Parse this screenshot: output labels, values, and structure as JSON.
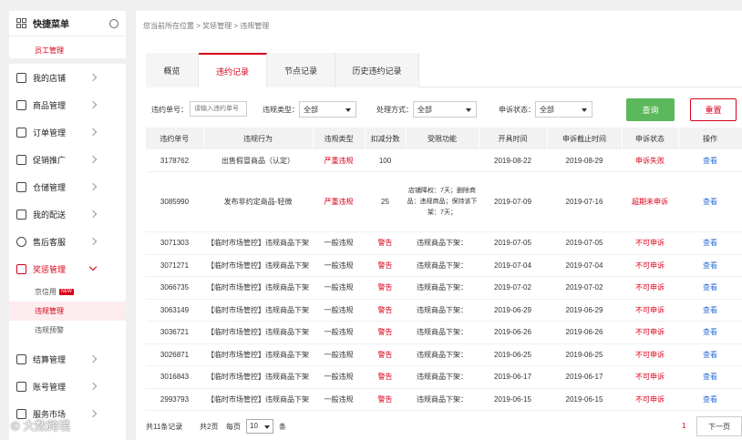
{
  "sidebar": {
    "title": "快捷菜单",
    "pinned": "员工管理",
    "items": [
      {
        "label": "我的店铺",
        "icon": "store-icon"
      },
      {
        "label": "商品管理",
        "icon": "box-icon"
      },
      {
        "label": "订单管理",
        "icon": "order-icon"
      },
      {
        "label": "促销推广",
        "icon": "promo-icon"
      },
      {
        "label": "仓储管理",
        "icon": "warehouse-icon"
      },
      {
        "label": "我的配送",
        "icon": "truck-icon"
      },
      {
        "label": "售后客服",
        "icon": "service-icon"
      },
      {
        "label": "奖惩管理",
        "icon": "award-icon"
      }
    ],
    "sub_items": [
      {
        "label": "京信用",
        "badge": "NEW"
      },
      {
        "label": "违规管理"
      },
      {
        "label": "违规预警"
      }
    ],
    "items_after": [
      {
        "label": "结算管理",
        "icon": "settle-icon"
      },
      {
        "label": "账号管理",
        "icon": "account-icon"
      },
      {
        "label": "服务市场",
        "icon": "market-icon"
      }
    ]
  },
  "breadcrumb": "您当前所在位置 > 奖惩管理 > 违规管理",
  "tabs": [
    "概览",
    "违约记录",
    "节点记录",
    "历史违约记录"
  ],
  "filters": {
    "order_label": "违约单号：",
    "order_placeholder": "请输入违约单号",
    "type_label": "违规类型：",
    "type_value": "全部",
    "handle_label": "处理方式：",
    "handle_value": "全部",
    "appeal_label": "申诉状态：",
    "appeal_value": "全部",
    "query": "查询",
    "reset": "重置"
  },
  "table": {
    "headers": [
      "违约单号",
      "违规行为",
      "违规类型",
      "扣减分数",
      "受限功能",
      "开具时间",
      "申诉截止时间",
      "申诉状态",
      "操作"
    ],
    "rows": [
      [
        "3178762",
        "出售假冒商品（认定）",
        "严重违规",
        "100",
        "",
        "2019-08-22",
        "2019-08-29",
        "申诉失败",
        "查看"
      ],
      [
        "3085990",
        "发布非约定商品-轻微",
        "严重违规",
        "25",
        "店铺降权：7天；删除商品：违规商品；保持该下架：7天；",
        "2019-07-09",
        "2019-07-16",
        "超期未申诉",
        "查看"
      ],
      [
        "3071303",
        "【临时市场管控】违规商品下架",
        "一般违规",
        "警告",
        "违规商品下架：",
        "2019-07-05",
        "2019-07-05",
        "不可申诉",
        "查看"
      ],
      [
        "3071271",
        "【临时市场管控】违规商品下架",
        "一般违规",
        "警告",
        "违规商品下架：",
        "2019-07-04",
        "2019-07-04",
        "不可申诉",
        "查看"
      ],
      [
        "3066735",
        "【临时市场管控】违规商品下架",
        "一般违规",
        "警告",
        "违规商品下架：",
        "2019-07-02",
        "2019-07-02",
        "不可申诉",
        "查看"
      ],
      [
        "3063149",
        "【临时市场管控】违规商品下架",
        "一般违规",
        "警告",
        "违规商品下架：",
        "2019-06-29",
        "2019-06-29",
        "不可申诉",
        "查看"
      ],
      [
        "3036721",
        "【临时市场管控】违规商品下架",
        "一般违规",
        "警告",
        "违规商品下架：",
        "2019-06-26",
        "2019-06-26",
        "不可申诉",
        "查看"
      ],
      [
        "3026871",
        "【临时市场管控】违规商品下架",
        "一般违规",
        "警告",
        "违规商品下架：",
        "2019-06-25",
        "2019-06-25",
        "不可申诉",
        "查看"
      ],
      [
        "3016843",
        "【临时市场管控】违规商品下架",
        "一般违规",
        "警告",
        "违规商品下架：",
        "2019-06-17",
        "2019-06-17",
        "不可申诉",
        "查看"
      ],
      [
        "2993793",
        "【临时市场管控】违规商品下架",
        "一般违规",
        "警告",
        "违规商品下架：",
        "2019-06-15",
        "2019-06-15",
        "不可申诉",
        "查看"
      ]
    ]
  },
  "pager": {
    "total": "共11条记录",
    "pages": "共2页",
    "per_label": "每页",
    "per_value": "10",
    "unit": "条",
    "current": "1",
    "next": "下一页"
  },
  "watermark": "© 大数跨境",
  "colors": {
    "accent": "#d9001b",
    "query_btn": "#5cb85c",
    "link": "#2a6edb"
  }
}
